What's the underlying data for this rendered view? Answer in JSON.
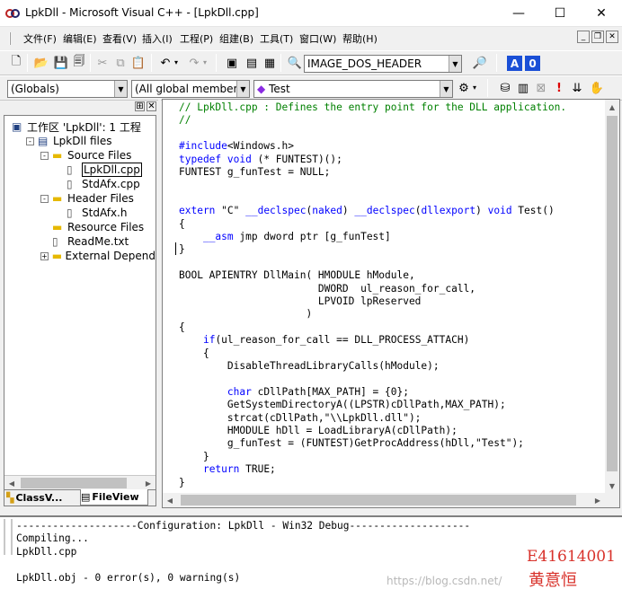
{
  "window": {
    "title": "LpkDll - Microsoft Visual C++ - [LpkDll.cpp]"
  },
  "menu": [
    "文件(F)",
    "编辑(E)",
    "查看(V)",
    "插入(I)",
    "工程(P)",
    "组建(B)",
    "工具(T)",
    "窗口(W)",
    "帮助(H)"
  ],
  "toolbar": {
    "find_value": "IMAGE_DOS_HEADER"
  },
  "wizardbar": {
    "scope": "(Globals)",
    "members": "(All global members",
    "function": "Test"
  },
  "workspace": {
    "tree": [
      {
        "label": "工作区 'LpkDll': 1 工程",
        "level": 0,
        "expander": "",
        "icon": "workspace"
      },
      {
        "label": "LpkDll files",
        "level": 1,
        "expander": "-",
        "icon": "project"
      },
      {
        "label": "Source Files",
        "level": 2,
        "expander": "-",
        "icon": "folder"
      },
      {
        "label": "LpkDll.cpp",
        "level": 3,
        "expander": "",
        "icon": "file",
        "selected": true
      },
      {
        "label": "StdAfx.cpp",
        "level": 3,
        "expander": "",
        "icon": "file"
      },
      {
        "label": "Header Files",
        "level": 2,
        "expander": "-",
        "icon": "folder"
      },
      {
        "label": "StdAfx.h",
        "level": 3,
        "expander": "",
        "icon": "file"
      },
      {
        "label": "Resource Files",
        "level": 2,
        "expander": "",
        "icon": "folder"
      },
      {
        "label": "ReadMe.txt",
        "level": 2,
        "expander": "",
        "icon": "file"
      },
      {
        "label": "External Depend",
        "level": 2,
        "expander": "+",
        "icon": "folder"
      }
    ],
    "tabs": [
      "ClassV...",
      "FileView"
    ]
  },
  "code": [
    [
      [
        "cm",
        "// LpkDll.cpp : Defines the entry point for the DLL application."
      ]
    ],
    [
      [
        "cm",
        "//"
      ]
    ],
    [
      [
        "",
        ""
      ]
    ],
    [
      [
        "kw",
        "#include"
      ],
      [
        "",
        "<Windows.h>"
      ]
    ],
    [
      [
        "kw",
        "typedef"
      ],
      [
        "",
        " "
      ],
      [
        "kw",
        "void"
      ],
      [
        "",
        " (* FUNTEST)();"
      ]
    ],
    [
      [
        "",
        "FUNTEST g_funTest = NULL;"
      ]
    ],
    [
      [
        "",
        ""
      ]
    ],
    [
      [
        "",
        ""
      ]
    ],
    [
      [
        "kw",
        "extern"
      ],
      [
        "",
        " \"C\" "
      ],
      [
        "kw",
        "__declspec"
      ],
      [
        "",
        "("
      ],
      [
        "kw",
        "naked"
      ],
      [
        "",
        ") "
      ],
      [
        "kw",
        "__declspec"
      ],
      [
        "",
        "("
      ],
      [
        "kw",
        "dllexport"
      ],
      [
        "",
        ") "
      ],
      [
        "kw",
        "void"
      ],
      [
        "",
        " Test()"
      ]
    ],
    [
      [
        "",
        "{"
      ]
    ],
    [
      [
        "",
        "    "
      ],
      [
        "kw",
        "__asm"
      ],
      [
        "",
        " jmp dword ptr [g_funTest]"
      ]
    ],
    [
      [
        "",
        "}"
      ]
    ],
    [
      [
        "",
        ""
      ]
    ],
    [
      [
        "",
        "BOOL APIENTRY DllMain( HMODULE hModule,"
      ]
    ],
    [
      [
        "",
        "                       DWORD  ul_reason_for_call,"
      ]
    ],
    [
      [
        "",
        "                       LPVOID lpReserved"
      ]
    ],
    [
      [
        "",
        "                     )"
      ]
    ],
    [
      [
        "",
        "{"
      ]
    ],
    [
      [
        "",
        "    "
      ],
      [
        "kw",
        "if"
      ],
      [
        "",
        "(ul_reason_for_call == DLL_PROCESS_ATTACH)"
      ]
    ],
    [
      [
        "",
        "    {"
      ]
    ],
    [
      [
        "",
        "        DisableThreadLibraryCalls(hModule);"
      ]
    ],
    [
      [
        "",
        ""
      ]
    ],
    [
      [
        "",
        "        "
      ],
      [
        "kw",
        "char"
      ],
      [
        "",
        " cDllPath[MAX_PATH] = {0};"
      ]
    ],
    [
      [
        "",
        "        GetSystemDirectoryA((LPSTR)cDllPath,MAX_PATH);"
      ]
    ],
    [
      [
        "",
        "        strcat(cDllPath,\"\\\\LpkDll.dll\");"
      ]
    ],
    [
      [
        "",
        "        HMODULE hDll = LoadLibraryA(cDllPath);"
      ]
    ],
    [
      [
        "",
        "        g_funTest = (FUNTEST)GetProcAddress(hDll,\"Test\");"
      ]
    ],
    [
      [
        "",
        "    }"
      ]
    ],
    [
      [
        "",
        "    "
      ],
      [
        "kw",
        "return"
      ],
      [
        "",
        " TRUE;"
      ]
    ],
    [
      [
        "",
        "}"
      ]
    ]
  ],
  "output": {
    "lines": [
      "--------------------Configuration: LpkDll - Win32 Debug--------------------",
      "Compiling...",
      "LpkDll.cpp",
      "",
      "LpkDll.obj - 0 error(s), 0 warning(s)"
    ]
  },
  "watermark": {
    "id": "E41614001",
    "name": "黄意恒",
    "url": "https://blog.csdn.net/"
  },
  "colors": {
    "keyword": "#0000ff",
    "comment": "#008000",
    "watermark_red": "#d8312a"
  }
}
